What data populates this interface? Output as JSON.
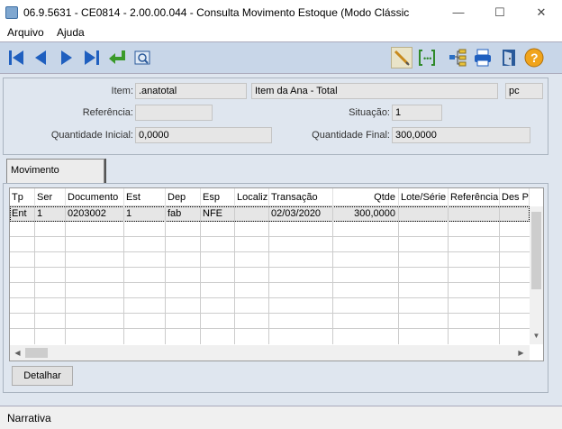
{
  "window": {
    "title": "06.9.5631 - CE0814 - 2.00.00.044 - Consulta Movimento Estoque (Modo Clássic",
    "minimize": "—",
    "maximize": "☐",
    "close": "✕"
  },
  "menu": {
    "arquivo": "Arquivo",
    "ajuda": "Ajuda"
  },
  "toolbar": {
    "icons": [
      "first-icon",
      "prev-icon",
      "next-icon",
      "last-icon",
      "return-icon",
      "search-doc-icon",
      "pen-icon",
      "formula-icon",
      "tree-icon",
      "printer-icon",
      "exit-door-icon",
      "help-icon"
    ]
  },
  "header": {
    "item_label": "Item:",
    "item_code": ".anatotal",
    "item_desc": "Item da Ana - Total",
    "item_unit": "pc",
    "referencia_label": "Referência:",
    "referencia_value": "",
    "situacao_label": "Situação:",
    "situacao_value": "1",
    "qtd_inicial_label": "Quantidade Inicial:",
    "qtd_inicial_value": "0,0000",
    "qtd_final_label": "Quantidade Final:",
    "qtd_final_value": "300,0000"
  },
  "tab": {
    "label": "Movimento"
  },
  "grid": {
    "columns": [
      "Tp",
      "Ser",
      "Documento",
      "Est",
      "Dep",
      "Esp",
      "Localiz",
      "Transação",
      "Qtde",
      "Lote/Série",
      "Referência",
      "Des Pl"
    ],
    "rows": [
      [
        "Ent",
        "1",
        "0203002",
        "1",
        "fab",
        "NFE",
        "",
        "02/03/2020",
        "300,0000",
        "",
        "",
        ""
      ]
    ]
  },
  "buttons": {
    "detalhar": "Detalhar"
  },
  "status": {
    "text": "Narrativa"
  }
}
